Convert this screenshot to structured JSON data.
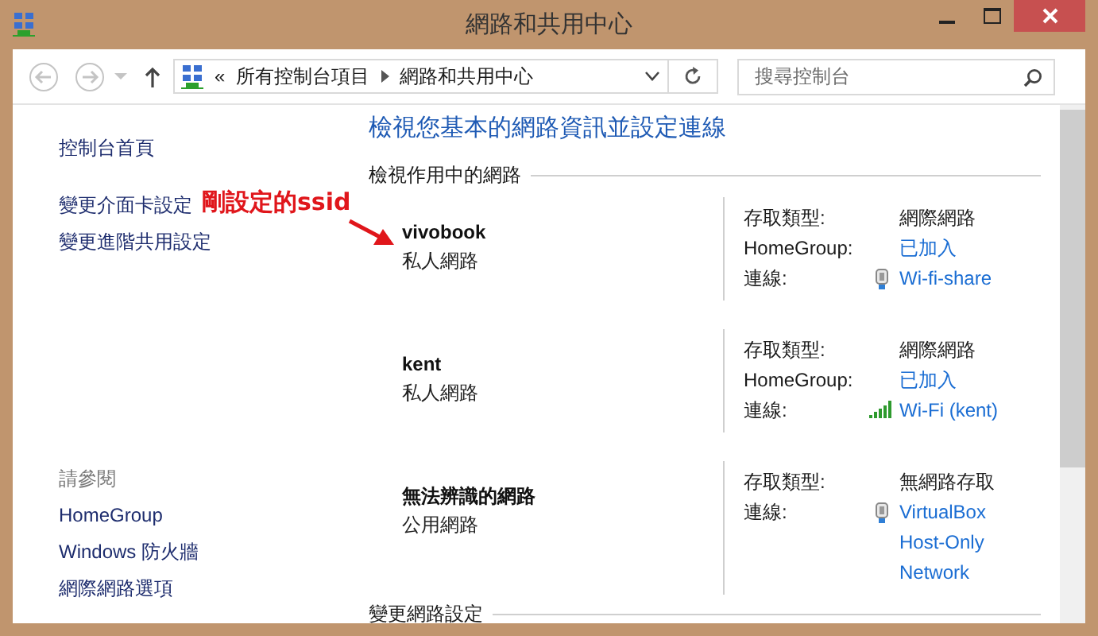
{
  "window": {
    "title": "網路和共用中心"
  },
  "address_bar": {
    "overflow": "«",
    "path": [
      "所有控制台項目",
      "網路和共用中心"
    ]
  },
  "search": {
    "placeholder": "搜尋控制台"
  },
  "sidebar": {
    "home": "控制台首頁",
    "tasks": [
      "變更介面卡設定",
      "變更進階共用設定"
    ],
    "see_also": {
      "heading": "請參閱",
      "links": [
        "HomeGroup",
        "Windows 防火牆",
        "網際網路選項"
      ]
    }
  },
  "main": {
    "heading": "檢視您基本的網路資訊並設定連線",
    "active_title": "檢視作用中的網路",
    "networks": [
      {
        "name": "vivobook",
        "category": "私人網路",
        "details": [
          {
            "label": "存取類型:",
            "value": "網際網路",
            "kind": "text"
          },
          {
            "label": "HomeGroup:",
            "value": "已加入",
            "kind": "link"
          },
          {
            "label": "連線:",
            "value": "Wi-fi-share",
            "kind": "adapter"
          }
        ]
      },
      {
        "name": "kent",
        "category": "私人網路",
        "details": [
          {
            "label": "存取類型:",
            "value": "網際網路",
            "kind": "text"
          },
          {
            "label": "HomeGroup:",
            "value": "已加入",
            "kind": "link"
          },
          {
            "label": "連線:",
            "value": "Wi-Fi (kent)",
            "kind": "wireless"
          }
        ]
      },
      {
        "name": "無法辨識的網路",
        "category": "公用網路",
        "details": [
          {
            "label": "存取類型:",
            "value": "無網路存取",
            "kind": "text"
          },
          {
            "label": "連線:",
            "value": "VirtualBox Host-Only Network",
            "kind": "adapter"
          }
        ]
      }
    ],
    "change_title": "變更網路設定"
  },
  "annotation": {
    "text": "剛設定的ssid"
  }
}
